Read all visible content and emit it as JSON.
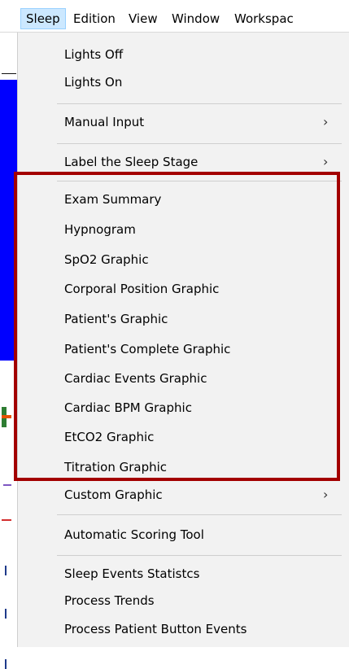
{
  "menubar": {
    "items": [
      "Sleep",
      "Edition",
      "View",
      "Window",
      "Workspac"
    ],
    "active": "Sleep"
  },
  "dropdown": {
    "group1": [
      "Lights Off",
      "Lights On"
    ],
    "manual_input": "Manual Input",
    "label_sleep_stage": "Label the Sleep Stage",
    "graphics": [
      "Exam Summary",
      "Hypnogram",
      "SpO2 Graphic",
      "Corporal Position Graphic",
      "Patient's Graphic",
      "Patient's Complete Graphic",
      "Cardiac Events Graphic",
      "Cardiac BPM Graphic",
      "EtCO2 Graphic",
      "Titration Graphic"
    ],
    "custom_graphic": "Custom Graphic",
    "automatic_scoring": "Automatic Scoring Tool",
    "tools": [
      "Sleep Events Statistcs",
      "Process Trends",
      "Process Patient Button Events"
    ],
    "submenu_arrow": "›"
  },
  "colors": {
    "highlight_border": "#a30000",
    "menu_bg": "#f2f2f2",
    "active_menubar_bg": "#cce8ff",
    "background_signal": "#0000ff"
  }
}
